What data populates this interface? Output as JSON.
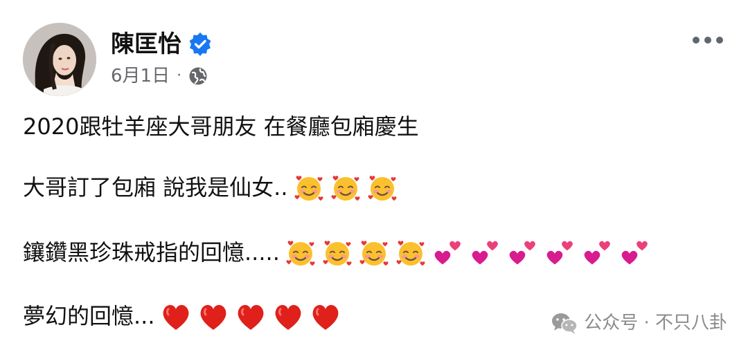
{
  "post": {
    "author": "陳匡怡",
    "verified_icon": "verified-badge-icon",
    "date": "6月1日",
    "separator": "·",
    "privacy_icon": "globe-icon",
    "more_icon": "more-options-icon",
    "lines": [
      {
        "text": "2020跟牡羊座大哥朋友 在餐廳包廂慶生",
        "emoji": []
      },
      {
        "text": "大哥訂了包廂 說我是仙女..",
        "emoji": [
          "smiling-face-with-hearts",
          "smiling-face-with-hearts",
          "smiling-face-with-hearts"
        ]
      },
      {
        "text": "鑲鑽黑珍珠戒指的回憶.....",
        "emoji": [
          "smiling-face-with-hearts",
          "smiling-face-with-hearts",
          "smiling-face-with-hearts",
          "smiling-face-with-hearts",
          "two-hearts",
          "two-hearts",
          "two-hearts",
          "two-hearts",
          "two-hearts",
          "two-hearts"
        ]
      },
      {
        "text": "夢幻的回憶...",
        "emoji": [
          "red-heart",
          "red-heart",
          "red-heart",
          "red-heart",
          "red-heart"
        ]
      }
    ]
  },
  "watermark": {
    "icon": "wechat-icon",
    "text": "公众号 · 不只八卦"
  },
  "colors": {
    "verified_blue": "#1877f2",
    "meta_gray": "#65676b",
    "heart_red": "#e0201b",
    "pink_heart": "#e0359a"
  }
}
